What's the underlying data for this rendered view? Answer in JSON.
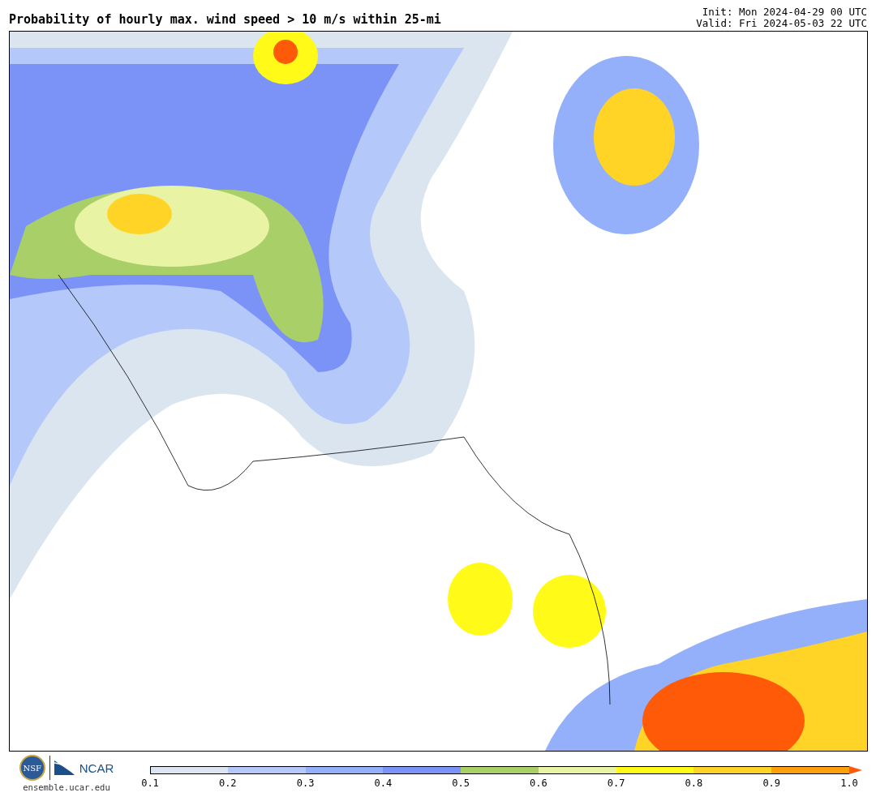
{
  "title": "Probability of hourly max. wind speed > 10 m/s within 25-mi",
  "init": "Init: Mon 2024-04-29 00 UTC",
  "valid": "Valid: Fri 2024-05-03 22 UTC",
  "logos": {
    "nsf": "NSF",
    "ncar": "NCAR",
    "site": "ensemble.ucar.edu"
  },
  "colorbar": {
    "bins": [
      {
        "color": "#dbe5f0"
      },
      {
        "color": "#b4c8fa"
      },
      {
        "color": "#94b0fa"
      },
      {
        "color": "#7b93f7"
      },
      {
        "color": "#a8cf68"
      },
      {
        "color": "#e8f4a4"
      },
      {
        "color": "#fffa18"
      },
      {
        "color": "#ffd426"
      },
      {
        "color": "#ff9f0c"
      }
    ],
    "extension": {
      "color": "#ff5a08"
    },
    "ticks": [
      "0.1",
      "0.2",
      "0.3",
      "0.4",
      "0.5",
      "0.6",
      "0.7",
      "0.8",
      "0.9",
      "1.0"
    ]
  }
}
